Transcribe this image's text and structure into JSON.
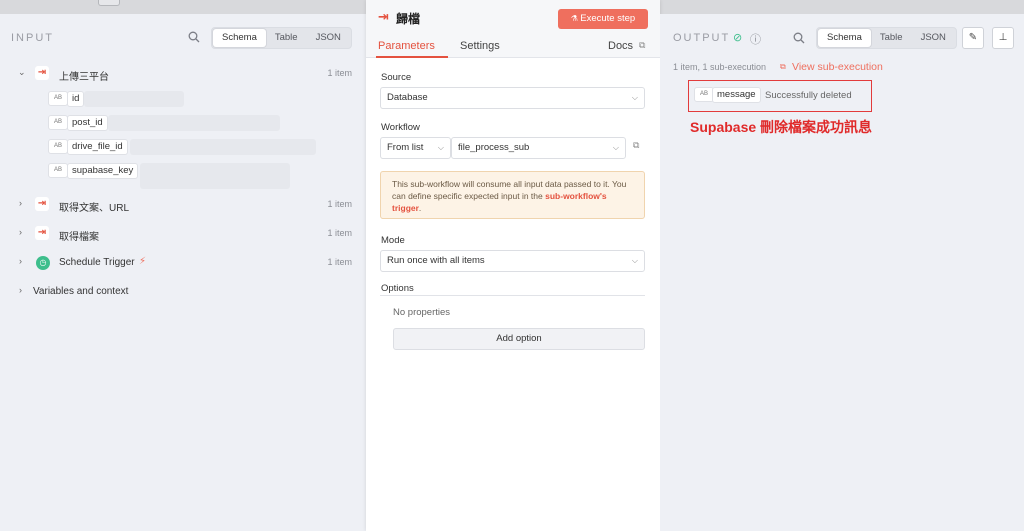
{
  "input": {
    "title": "INPUT",
    "view_tabs": [
      "Schema",
      "Table",
      "JSON"
    ],
    "active_tab": "Schema",
    "nodes": [
      {
        "label": "上傳三平台",
        "count": "1 item",
        "expanded": true
      },
      {
        "label": "取得文案、URL",
        "count": "1 item"
      },
      {
        "label": "取得檔案",
        "count": "1 item"
      },
      {
        "label": "Schedule Trigger",
        "count": "1 item"
      }
    ],
    "fields": [
      {
        "type": "AB",
        "name": "id"
      },
      {
        "type": "AB",
        "name": "post_id"
      },
      {
        "type": "AB",
        "name": "drive_file_id"
      },
      {
        "type": "AB",
        "name": "supabase_key"
      }
    ],
    "variables_label": "Variables and context"
  },
  "node": {
    "title": "歸檔",
    "execute_label": "Execute step",
    "tabs": {
      "parameters": "Parameters",
      "settings": "Settings",
      "docs": "Docs"
    },
    "source": {
      "label": "Source",
      "value": "Database"
    },
    "workflow": {
      "label": "Workflow",
      "mode": "From list",
      "value": "file_process_sub"
    },
    "notice": {
      "text": "This sub-workflow will consume all input data passed to it. You can define specific expected input in the",
      "link": "sub-workflow's trigger",
      "end": "."
    },
    "mode": {
      "label": "Mode",
      "value": "Run once with all items"
    },
    "options": {
      "label": "Options",
      "empty": "No properties",
      "add_label": "Add option"
    }
  },
  "output": {
    "title": "OUTPUT",
    "view_tabs": [
      "Schema",
      "Table",
      "JSON"
    ],
    "active_tab": "Schema",
    "meta": "1 item, 1 sub-execution",
    "view_sub_label": "View sub-execution",
    "field": {
      "type": "AB",
      "name": "message",
      "value": "Successfully deleted"
    }
  },
  "annotation": "Supabase 刪除檔案成功訊息",
  "colors": {
    "accent": "#e4523f",
    "success": "#3dbe8c",
    "annotation": "#e02a2a"
  }
}
